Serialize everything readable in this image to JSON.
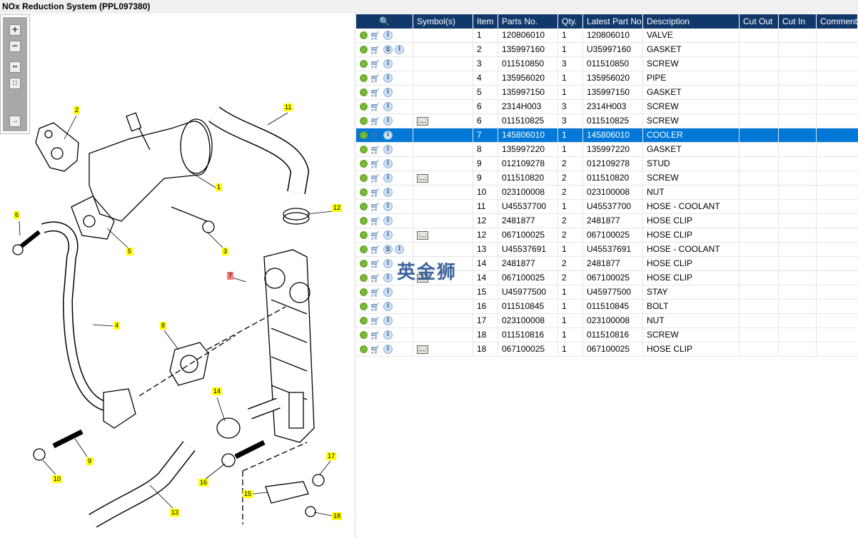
{
  "title": "NOx Reduction System (PPL097380)",
  "toolbar": {
    "buttons": [
      "zoom-in",
      "zoom-out",
      "fit-all",
      "fit-window",
      "export"
    ]
  },
  "callouts": [
    {
      "n": "2",
      "l": 103,
      "t": 149
    },
    {
      "n": "11",
      "l": 397,
      "t": 145
    },
    {
      "n": "1",
      "l": 302,
      "t": 257
    },
    {
      "n": "12",
      "l": 465,
      "t": 286
    },
    {
      "n": "6",
      "l": 19,
      "t": 296
    },
    {
      "n": "5",
      "l": 177,
      "t": 347
    },
    {
      "n": "3",
      "l": 311,
      "t": 347
    },
    {
      "n": "7",
      "l": 318,
      "t": 381,
      "red": true
    },
    {
      "n": "4",
      "l": 159,
      "t": 451
    },
    {
      "n": "8",
      "l": 224,
      "t": 451
    },
    {
      "n": "14",
      "l": 297,
      "t": 543
    },
    {
      "n": "9",
      "l": 121,
      "t": 641
    },
    {
      "n": "17",
      "l": 457,
      "t": 634
    },
    {
      "n": "10",
      "l": 73,
      "t": 666
    },
    {
      "n": "16",
      "l": 278,
      "t": 671
    },
    {
      "n": "15",
      "l": 340,
      "t": 687
    },
    {
      "n": "13",
      "l": 238,
      "t": 713
    },
    {
      "n": "18",
      "l": 465,
      "t": 718
    }
  ],
  "table": {
    "headers": [
      "",
      "Symbol(s)",
      "Item",
      "Parts No.",
      "Qty.",
      "Latest Part No.",
      "Description",
      "Cut Out",
      "Cut In",
      "Comment"
    ],
    "rows": [
      {
        "s": false,
        "b": false,
        "item": "1",
        "part": "120806010",
        "qty": "1",
        "latest": "120806010",
        "desc": "VALVE"
      },
      {
        "s": true,
        "b": false,
        "item": "2",
        "part": "135997160",
        "qty": "1",
        "latest": "U35997160",
        "desc": "GASKET"
      },
      {
        "s": false,
        "b": false,
        "item": "3",
        "part": "011510850",
        "qty": "3",
        "latest": "011510850",
        "desc": "SCREW"
      },
      {
        "s": false,
        "b": false,
        "item": "4",
        "part": "135956020",
        "qty": "1",
        "latest": "135956020",
        "desc": "PIPE"
      },
      {
        "s": false,
        "b": false,
        "item": "5",
        "part": "135997150",
        "qty": "1",
        "latest": "135997150",
        "desc": "GASKET"
      },
      {
        "s": false,
        "b": false,
        "item": "6",
        "part": "2314H003",
        "qty": "3",
        "latest": "2314H003",
        "desc": "SCREW"
      },
      {
        "s": false,
        "b": true,
        "item": "6",
        "part": "011510825",
        "qty": "3",
        "latest": "011510825",
        "desc": "SCREW"
      },
      {
        "s": false,
        "b": false,
        "item": "7",
        "part": "145806010",
        "qty": "1",
        "latest": "145806010",
        "desc": "COOLER",
        "selected": true
      },
      {
        "s": false,
        "b": false,
        "item": "8",
        "part": "135997220",
        "qty": "1",
        "latest": "135997220",
        "desc": "GASKET"
      },
      {
        "s": false,
        "b": false,
        "item": "9",
        "part": "012109278",
        "qty": "2",
        "latest": "012109278",
        "desc": "STUD"
      },
      {
        "s": false,
        "b": true,
        "item": "9",
        "part": "011510820",
        "qty": "2",
        "latest": "011510820",
        "desc": "SCREW"
      },
      {
        "s": false,
        "b": false,
        "item": "10",
        "part": "023100008",
        "qty": "2",
        "latest": "023100008",
        "desc": "NUT"
      },
      {
        "s": false,
        "b": false,
        "item": "11",
        "part": "U45537700",
        "qty": "1",
        "latest": "U45537700",
        "desc": "HOSE - COOLANT"
      },
      {
        "s": false,
        "b": false,
        "item": "12",
        "part": "2481877",
        "qty": "2",
        "latest": "2481877",
        "desc": "HOSE CLIP"
      },
      {
        "s": false,
        "b": true,
        "item": "12",
        "part": "067100025",
        "qty": "2",
        "latest": "067100025",
        "desc": "HOSE CLIP"
      },
      {
        "s": true,
        "b": false,
        "item": "13",
        "part": "U45537691",
        "qty": "1",
        "latest": "U45537691",
        "desc": "HOSE - COOLANT"
      },
      {
        "s": false,
        "b": false,
        "item": "14",
        "part": "2481877",
        "qty": "2",
        "latest": "2481877",
        "desc": "HOSE CLIP"
      },
      {
        "s": false,
        "b": true,
        "item": "14",
        "part": "067100025",
        "qty": "2",
        "latest": "067100025",
        "desc": "HOSE CLIP"
      },
      {
        "s": false,
        "b": false,
        "item": "15",
        "part": "U45977500",
        "qty": "1",
        "latest": "U45977500",
        "desc": "STAY"
      },
      {
        "s": false,
        "b": false,
        "item": "16",
        "part": "011510845",
        "qty": "1",
        "latest": "011510845",
        "desc": "BOLT"
      },
      {
        "s": false,
        "b": false,
        "item": "17",
        "part": "023100008",
        "qty": "1",
        "latest": "023100008",
        "desc": "NUT"
      },
      {
        "s": false,
        "b": false,
        "item": "18",
        "part": "011510816",
        "qty": "1",
        "latest": "011510816",
        "desc": "SCREW"
      },
      {
        "s": false,
        "b": true,
        "item": "18",
        "part": "067100025",
        "qty": "1",
        "latest": "067100025",
        "desc": "HOSE CLIP"
      }
    ]
  },
  "watermark": "英金狮",
  "colors": {
    "header": "#10386b",
    "selected": "#0078d7",
    "callout": "#ffff00",
    "callout_selected": "#ff7b7b"
  }
}
